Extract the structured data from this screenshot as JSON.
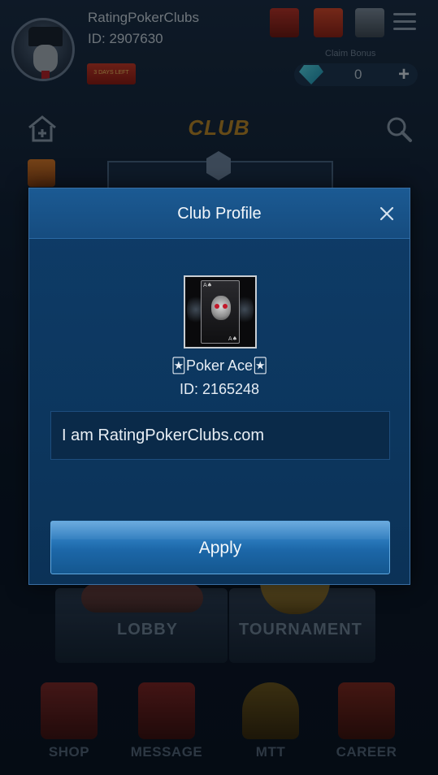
{
  "profile": {
    "username": "RatingPokerClubs",
    "user_id": "ID: 2907630",
    "days_badge": "3 DAYS LEFT"
  },
  "claim_bonus": {
    "label": "Claim Bonus",
    "gem_count": "0",
    "add_symbol": "+"
  },
  "club_header": {
    "title": "CLUB"
  },
  "modes": {
    "lobby": "LOBBY",
    "tournament": "TOURNAMENT"
  },
  "bottom_nav": {
    "shop": "SHOP",
    "message": "MESSAGE",
    "mtt": "MTT",
    "career": "CAREER"
  },
  "modal": {
    "title": "Club Profile",
    "club_name": "🃏Poker Ace🃏",
    "club_id": "ID: 2165248",
    "description": "I am RatingPokerClubs.com",
    "apply_label": "Apply"
  },
  "colors": {
    "modal_bg": "#0e3c68",
    "modal_header": "#1b5a93",
    "apply_button": "#2f7fc2",
    "club_title_gold": "#b9882a"
  }
}
